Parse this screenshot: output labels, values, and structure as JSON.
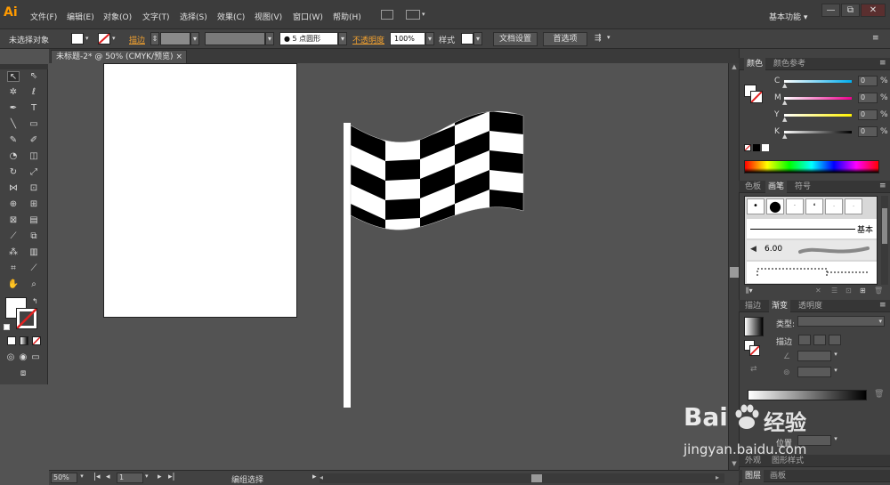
{
  "app": {
    "logo": "Ai",
    "workspace": "基本功能 ▾"
  },
  "menu": [
    "文件(F)",
    "编辑(E)",
    "对象(O)",
    "文字(T)",
    "选择(S)",
    "效果(C)",
    "视图(V)",
    "窗口(W)",
    "帮助(H)"
  ],
  "window_buttons": [
    "—",
    "⧉",
    "✕"
  ],
  "control": {
    "selection": "未选择对象",
    "stroke_label": "描边",
    "brush_label": "5 点圆形",
    "opacity_label": "不透明度",
    "opacity_value": "100%",
    "style_label": "样式",
    "doc_setup": "文档设置",
    "preferences": "首选项"
  },
  "document": {
    "tab_title": "未标题-2* @ 50% (CMYK/预览)"
  },
  "status": {
    "zoom": "50%",
    "page": "1",
    "status_text": "编组选择"
  },
  "panels": {
    "color_tabs": [
      "颜色",
      "颜色参考"
    ],
    "channels": [
      {
        "label": "C",
        "value": "0",
        "unit": "%"
      },
      {
        "label": "M",
        "value": "0",
        "unit": "%"
      },
      {
        "label": "Y",
        "value": "0",
        "unit": "%"
      },
      {
        "label": "K",
        "value": "0",
        "unit": "%"
      }
    ],
    "brush_tabs": [
      "色板",
      "画笔",
      "符号"
    ],
    "brush_basic": "基本",
    "brush_size": "6.00",
    "stroke_tabs": [
      "描边",
      "渐变",
      "透明度"
    ],
    "gradient_type_label": "类型:",
    "gradient_stroke_label": "描边",
    "gradient_position_label": "位置",
    "bottom_tabs": [
      "图层",
      "画板"
    ],
    "bottom_tab_partial": [
      "外观",
      "图形样式"
    ]
  },
  "watermark": {
    "brand": "Bai",
    "suffix": "经验",
    "url": "jingyan.baidu.com"
  }
}
